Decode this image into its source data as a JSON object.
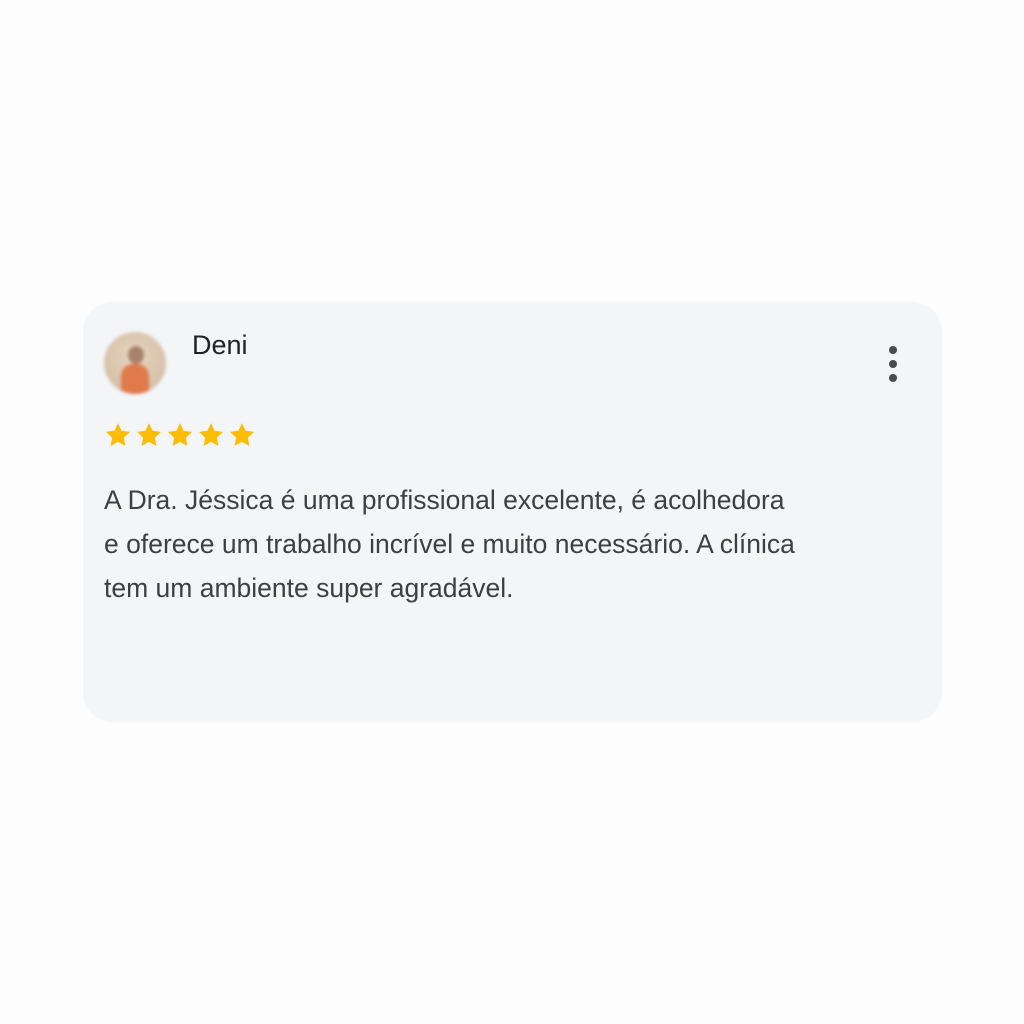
{
  "review": {
    "author": "Deni",
    "rating": 5,
    "rating_max": 5,
    "star_color": "#fbbc04",
    "icons": {
      "avatar": "user-avatar-photo",
      "menu": "more-vert-icon",
      "star": "star-icon"
    },
    "text": "A Dra. Jéssica é uma profissional excelente, é acolhedora\ne oferece um trabalho incrível e muito necessário. A clínica\ntem um ambiente super agradável."
  }
}
